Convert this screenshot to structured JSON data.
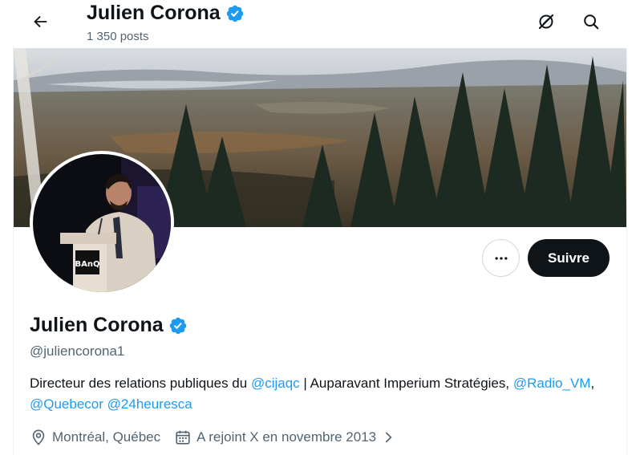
{
  "header": {
    "name": "Julien Corona",
    "posts": "1 350 posts"
  },
  "profile": {
    "name": "Julien Corona",
    "handle": "@juliencorona1",
    "verified": true,
    "follow_label": "Suivre",
    "more_label": "•••"
  },
  "bio": {
    "part1": "Directeur des relations publiques du ",
    "mention1": "@cijaqc",
    "part2": " | Auparavant Imperium Stratégies, ",
    "mention2": "@Radio_VM",
    "sep1": ", ",
    "mention3": "@Quebecor",
    "sep2": " ",
    "mention4": "@24heuresca"
  },
  "meta": {
    "location": "Montréal, Québec",
    "joined": "A rejoint X en novembre 2013"
  },
  "colors": {
    "accent": "#1d9bf0",
    "text": "#0f1419",
    "secondary": "#536471",
    "follow_bg": "#0f1419"
  },
  "icons": {
    "back": "arrow-left-icon",
    "grok": "grok-icon",
    "search": "search-icon",
    "verified": "verified-badge-icon",
    "location": "location-pin-icon",
    "calendar": "calendar-icon",
    "chevron": "chevron-right-icon"
  }
}
